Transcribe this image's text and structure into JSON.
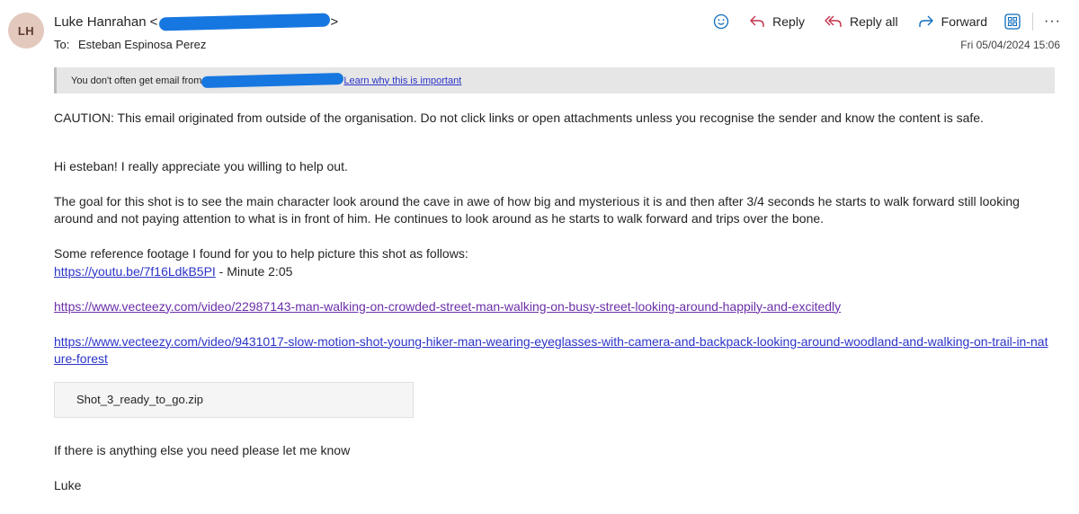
{
  "header": {
    "avatar_initials": "LH",
    "sender_name": "Luke Hanrahan",
    "sender_open": "<",
    "sender_close": ">",
    "to_label": "To:",
    "to_name": "Esteban Espinosa Perez",
    "date": "Fri 05/04/2024 15:06",
    "redaction_color": "#1777e0"
  },
  "actions": {
    "emoji_icon": "smiley-icon",
    "reply": "Reply",
    "reply_all": "Reply all",
    "forward": "Forward",
    "apps_icon": "apps-icon",
    "more": "···"
  },
  "infobar": {
    "text_before": "You don't often get email from",
    "link": "Learn why this is important"
  },
  "body": {
    "caution": "CAUTION: This email originated from outside of the organisation. Do not click links or open attachments unless you recognise the sender and know the content is safe.",
    "greeting": "Hi esteban! I really appreciate you willing to help out.",
    "paragraph": "The goal for this shot is to see the main character look around the cave in awe of how big and mysterious it is and then after 3/4 seconds he starts to walk forward still looking around and not paying attention to what is in front of him. He continues to look around as he starts to walk forward and trips over the bone.",
    "reference_intro": "Some reference footage I found for you to help picture this shot as follows:",
    "link1": "https://youtu.be/7f16LdkB5PI",
    "link1_suffix": " - Minute 2:05",
    "link2": "https://www.vecteezy.com/video/22987143-man-walking-on-crowded-street-man-walking-on-busy-street-looking-around-happily-and-excitedly",
    "link3": "https://www.vecteezy.com/video/9431017-slow-motion-shot-young-hiker-man-wearing-eyeglasses-with-camera-and-backpack-looking-around-woodland-and-walking-on-trail-in-nature-forest",
    "attachment": "Shot_3_ready_to_go.zip",
    "closing": "If there is anything else you need please let me know",
    "signature": "Luke"
  }
}
